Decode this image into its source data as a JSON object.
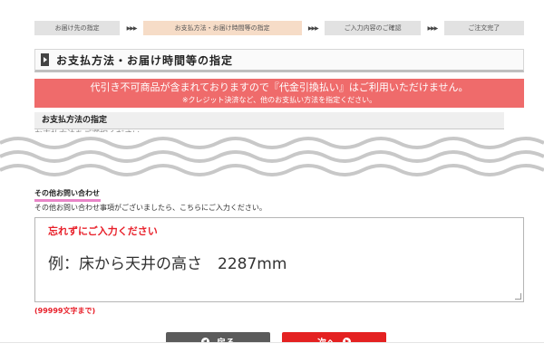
{
  "steps": [
    {
      "label": "お届け先の指定",
      "active": false
    },
    {
      "label": "お支払方法・お届け時間等の指定",
      "active": true
    },
    {
      "label": "ご入力内容のご確認",
      "active": false
    },
    {
      "label": "ご注文完了",
      "active": false
    }
  ],
  "step_separator": "▶▶▶",
  "page": {
    "section_title": "お支払方法・お届け時間等の指定"
  },
  "notice": {
    "main": "代引き不可商品が含まれておりますので『代金引換払い』はご利用いただけません。",
    "sub": "※クレジット決済など、他のお支払い方法を指定ください。",
    "color": "#ef6b6b"
  },
  "payment": {
    "heading": "お支払方法の指定",
    "instruction": "お支払方法をご選択ください。"
  },
  "inquiry": {
    "heading": "その他お問い合わせ",
    "description": "その他お問い合わせ事項がございましたら、こちらにご入力ください。",
    "reminder": "忘れずにご入力ください",
    "example": "例：床から天井の高さ　2287mm",
    "char_limit": "(99999文字まで)",
    "highlight_color": "#e985c8",
    "accent_color": "#e8202a"
  },
  "buttons": {
    "back_label": "戻る",
    "next_label": "次へ",
    "back_color": "#5b5b5b",
    "next_color": "#e42121"
  },
  "icons": [
    "triangle-right-icon",
    "back-arrow-icon",
    "next-arrow-icon",
    "resize-grip-icon"
  ]
}
